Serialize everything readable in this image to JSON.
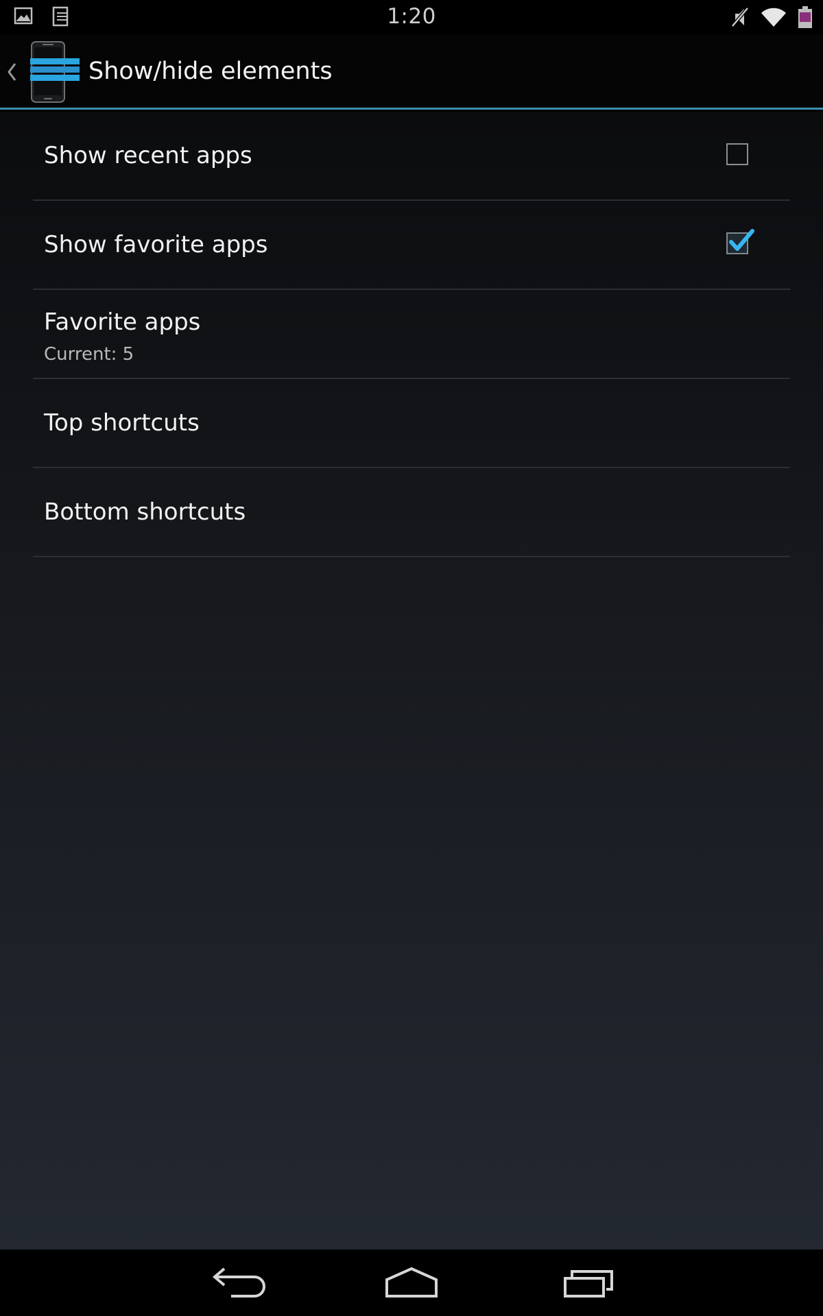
{
  "status_bar": {
    "time": "1:20",
    "left_icons": [
      "gallery-icon",
      "sd-card-icon"
    ],
    "right_icons": [
      "mute-icon",
      "wifi-icon",
      "battery-icon"
    ]
  },
  "action_bar": {
    "title": "Show/hide elements",
    "accent_color": "#3d91ad"
  },
  "preferences": [
    {
      "title": "Show recent apps",
      "type": "checkbox",
      "checked": false
    },
    {
      "title": "Show favorite apps",
      "type": "checkbox",
      "checked": true
    },
    {
      "title": "Favorite apps",
      "summary": "Current: 5",
      "type": "list"
    },
    {
      "title": "Top shortcuts",
      "type": "screen"
    },
    {
      "title": "Bottom shortcuts",
      "type": "screen"
    }
  ],
  "nav_bar": {
    "buttons": [
      "back-icon",
      "home-icon",
      "recents-icon"
    ]
  }
}
